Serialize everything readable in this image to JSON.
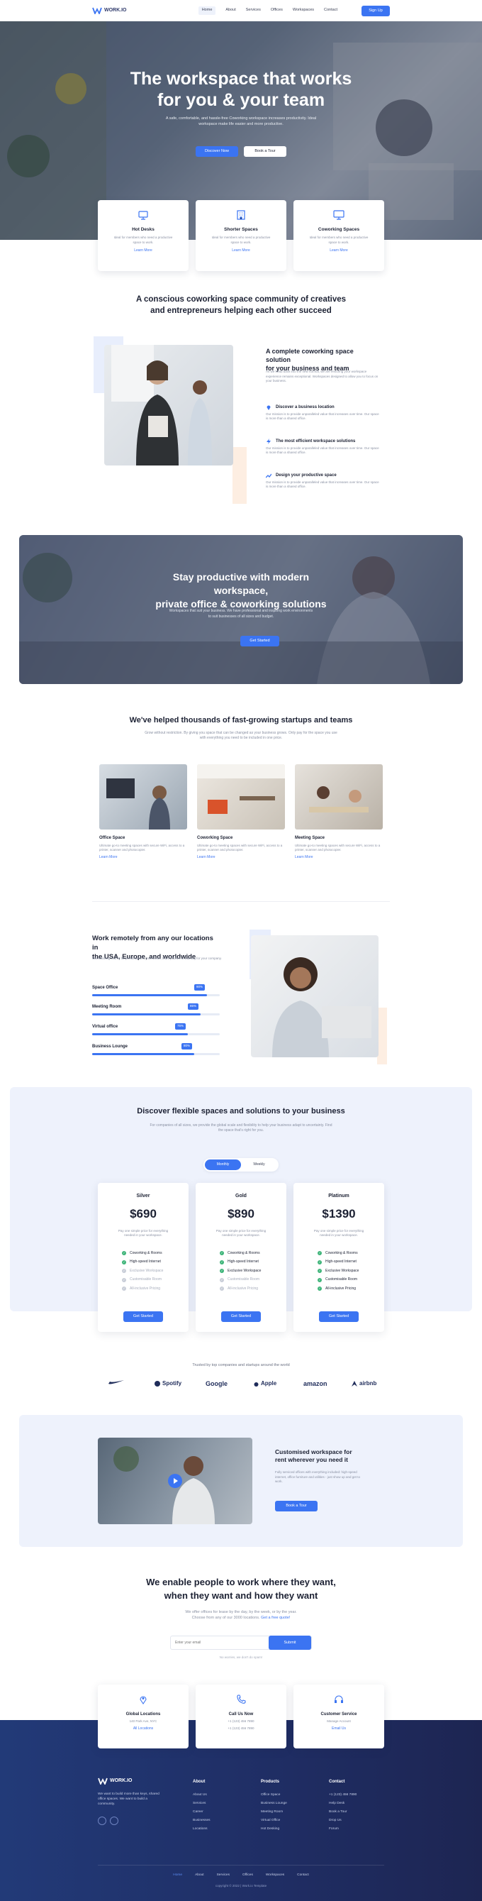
{
  "brand": {
    "name": "WORK.IO",
    "accent": "#3b74f2",
    "footer_bg": "#223a78"
  },
  "nav": {
    "items": [
      "Home",
      "About",
      "Services",
      "Offices",
      "Workspaces",
      "Contact"
    ],
    "active": "Home",
    "signup": "Sign Up"
  },
  "hero": {
    "title_line1": "The workspace that works",
    "title_line2": "for you & your team",
    "text": "A safe, comfortable, and hassle-free Coworking workspace increases productivity. Ideal workspace make life easier and more productive.",
    "primary_btn": "Discover Now",
    "secondary_btn": "Book a Tour"
  },
  "features": [
    {
      "icon": "desk-icon",
      "title": "Hot Desks",
      "text": "Ideal for members who need a productive space to work.",
      "link": "Learn More"
    },
    {
      "icon": "building-icon",
      "title": "Shorter Spaces",
      "text": "Ideal for members who need a productive space to work.",
      "link": "Learn More"
    },
    {
      "icon": "monitor-icon",
      "title": "Coworking Spaces",
      "text": "Ideal for members who need a productive space to work.",
      "link": "Learn More"
    }
  ],
  "community": {
    "title_line1": "A conscious coworking space community of creatives",
    "title_line2": "and entrepreneurs helping each other succeed",
    "heading_line1": "A complete coworking space solution",
    "heading_line2": "for your business and team",
    "text": "As we head back into the new normal, we are ensuring your workspace experience remains exceptional. Workspaces designed to allow you to focus on your business.",
    "items": [
      {
        "icon": "pin-icon",
        "title": "Discover a business location",
        "text": "Our mission is to provide unparalleled value that increases over time. Our space is more than a shared office."
      },
      {
        "icon": "bolt-icon",
        "title": "The most efficient workspace solutions",
        "text": "Our mission is to provide unparalleled value that increases over time. Our space is more than a shared office."
      },
      {
        "icon": "trend-icon",
        "title": "Design your productive space",
        "text": "Our mission is to provide unparalleled value that increases over time. Our space is more than a shared office."
      }
    ]
  },
  "banner": {
    "title_line1": "Stay productive with modern workspace,",
    "title_line2": "private office & coworking solutions",
    "text": "Workspaces that suit your business. We have professional and inspiring work environments to suit businesses of all sizes and budget.",
    "btn": "Get Started"
  },
  "helped": {
    "title": "We've helped thousands of fast-growing startups and teams",
    "text": "Grow without restriction. By giving you space that can be changed as your business grows. Only pay for the space you use with everything you need to be included in one price.",
    "cards": [
      {
        "title": "Office Space",
        "text": "Ultimate go-to meeting spaces with secure WiFi, access to a printer, scanner and photocopier.",
        "link": "Learn More"
      },
      {
        "title": "Coworking Space",
        "text": "Ultimate go-to meeting spaces with secure WiFi, access to a printer, scanner and photocopier.",
        "link": "Learn More"
      },
      {
        "title": "Meeting Space",
        "text": "Ultimate go-to meeting spaces with secure WiFi, access to a printer, scanner and photocopier.",
        "link": "Learn More"
      }
    ]
  },
  "remote": {
    "title_line1": "Work remotely from any our locations in",
    "title_line2": "the USA, Europe, and worldwide",
    "text": "Get stunning rooms for presentations, interviews, team pitches or training for your company.",
    "bars": [
      {
        "label": "Space Office",
        "value": 90
      },
      {
        "label": "Meeting Room",
        "value": 85
      },
      {
        "label": "Virtual office",
        "value": 75
      },
      {
        "label": "Business Lounge",
        "value": 80
      }
    ]
  },
  "pricing": {
    "title": "Discover flexible spaces and solutions to your business",
    "text": "For companies of all sizes, we provide the global scale and flexibility to help your business adapt to uncertainty. Find the space that's right for you.",
    "toggle": [
      "Monthly",
      "Weekly"
    ],
    "plans": [
      {
        "name": "Silver",
        "price": "$690",
        "desc": "Pay one simple price for everything needed in your workspace.",
        "features": [
          [
            "Coworking & Rooms",
            true
          ],
          [
            "High-speed Internet",
            true
          ],
          [
            "Exclusive Workspace",
            false
          ],
          [
            "Customisable Room",
            false
          ],
          [
            "All-inclusive Pricing",
            false
          ]
        ],
        "btn": "Get Started"
      },
      {
        "name": "Gold",
        "price": "$890",
        "desc": "Pay one simple price for everything needed in your workspace.",
        "features": [
          [
            "Coworking & Rooms",
            true
          ],
          [
            "High-speed Internet",
            true
          ],
          [
            "Exclusive Workspace",
            true
          ],
          [
            "Customisable Room",
            false
          ],
          [
            "All-inclusive Pricing",
            false
          ]
        ],
        "btn": "Get Started"
      },
      {
        "name": "Platinum",
        "price": "$1390",
        "desc": "Pay one simple price for everything needed in your workspace.",
        "features": [
          [
            "Coworking & Rooms",
            true
          ],
          [
            "High-speed Internet",
            true
          ],
          [
            "Exclusive Workspace",
            true
          ],
          [
            "Customisable Room",
            true
          ],
          [
            "All-inclusive Pricing",
            true
          ]
        ],
        "btn": "Get Started"
      }
    ]
  },
  "trusted": {
    "text": "Trusted by top companies and startups around the world",
    "logos": [
      {
        "icon": "nike-logo",
        "name": ""
      },
      {
        "icon": "spotify-logo",
        "name": "Spotify"
      },
      {
        "icon": "google-logo",
        "name": "Google"
      },
      {
        "icon": "apple-logo",
        "name": "Apple"
      },
      {
        "icon": "amazon-logo",
        "name": "amazon"
      },
      {
        "icon": "airbnb-logo",
        "name": "airbnb"
      }
    ]
  },
  "video": {
    "title_line1": "Customised workspace for",
    "title_line2": "rent wherever you need it",
    "text": "Fully serviced offices with everything included: high-speed internet, office furniture and utilities - just show up and get to work.",
    "btn": "Book a Tour"
  },
  "cta": {
    "title_line1": "We enable people to work where they want,",
    "title_line2": "when they want and how they want",
    "text1": "We offer offices for lease by the day, by the week, or by the year.",
    "text2_prefix": "Choose from any of our 3000 locations.",
    "text2_link": "Get a free quote!",
    "placeholder": "Enter your email",
    "submit": "Submit",
    "note": "No worries, we don't do spam!"
  },
  "contacts": [
    {
      "icon": "location-icon",
      "title": "Global Locations",
      "line1": "140 Park Ave, NYC",
      "link": "All Locations"
    },
    {
      "icon": "phone-icon",
      "title": "Call Us Now",
      "line1": "+1 (123) 456 7890",
      "line2": "+1 (123) 456 7890"
    },
    {
      "icon": "headset-icon",
      "title": "Customer Service",
      "line1": "Manage Account",
      "link": "Email Us"
    }
  ],
  "footer": {
    "desc": "We want to build more than keys, shared office spaces. We want to build a community.",
    "cols": [
      {
        "title": "About",
        "items": [
          "About Us",
          "Services",
          "Career",
          "Businesses",
          "Locations"
        ]
      },
      {
        "title": "Products",
        "items": [
          "Office Space",
          "Business Lounge",
          "Meeting Room",
          "Virtual Office",
          "Hot Desking"
        ]
      },
      {
        "title": "Contact",
        "items": [
          "+1 (123) 456 7890",
          "Help Desk",
          "Book a Tour",
          "Drop Us",
          "Forum"
        ]
      }
    ],
    "nav": [
      "Home",
      "About",
      "Services",
      "Offices",
      "Workspaces",
      "Contact"
    ],
    "copyright": "copyright © 2022 | Work.io Template"
  }
}
